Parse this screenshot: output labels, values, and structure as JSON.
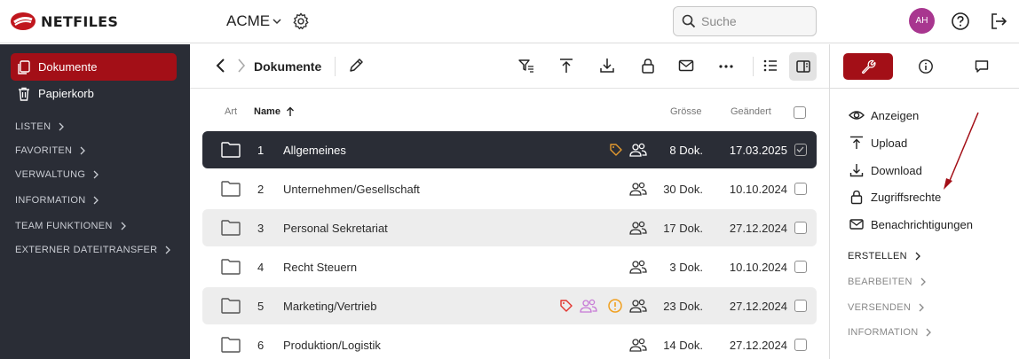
{
  "header": {
    "logo_text": "NETFILES",
    "org_name": "ACME",
    "search_placeholder": "Suche",
    "avatar_initials": "AH"
  },
  "sidebar": {
    "items": [
      {
        "label": "Dokumente",
        "active": true
      },
      {
        "label": "Papierkorb",
        "active": false
      }
    ],
    "sections": [
      "LISTEN",
      "FAVORITEN",
      "VERWALTUNG",
      "INFORMATION",
      "TEAM FUNKTIONEN",
      "EXTERNER DATEITRANSFER"
    ]
  },
  "toolbar": {
    "breadcrumb": "Dokumente"
  },
  "table": {
    "headers": {
      "type": "Art",
      "name": "Name",
      "size": "Grösse",
      "modified": "Geändert"
    },
    "rows": [
      {
        "num": "1",
        "name": "Allgemeines",
        "size": "8 Dok.",
        "date": "17.03.2025"
      },
      {
        "num": "2",
        "name": "Unternehmen/Gesellschaft",
        "size": "30 Dok.",
        "date": "10.10.2024"
      },
      {
        "num": "3",
        "name": "Personal Sekretariat",
        "size": "17 Dok.",
        "date": "27.12.2024"
      },
      {
        "num": "4",
        "name": "Recht Steuern",
        "size": "3 Dok.",
        "date": "10.10.2024"
      },
      {
        "num": "5",
        "name": "Marketing/Vertrieb",
        "size": "23 Dok.",
        "date": "27.12.2024"
      },
      {
        "num": "6",
        "name": "Produktion/Logistik",
        "size": "14 Dok.",
        "date": "27.12.2024"
      }
    ]
  },
  "rpanel": {
    "actions": [
      "Anzeigen",
      "Upload",
      "Download",
      "Zugriffsrechte",
      "Benachrichtigungen"
    ],
    "sections": [
      "ERSTELLEN",
      "BEARBEITEN",
      "VERSENDEN",
      "INFORMATION"
    ]
  },
  "colors": {
    "accent": "#a30f17",
    "sidebar_bg": "#2a2d36",
    "avatar": "#a8368f",
    "tag_orange": "#e59a2e",
    "tag_red": "#e2342e",
    "users_pink": "#c77ad6",
    "warning": "#f0a020"
  }
}
